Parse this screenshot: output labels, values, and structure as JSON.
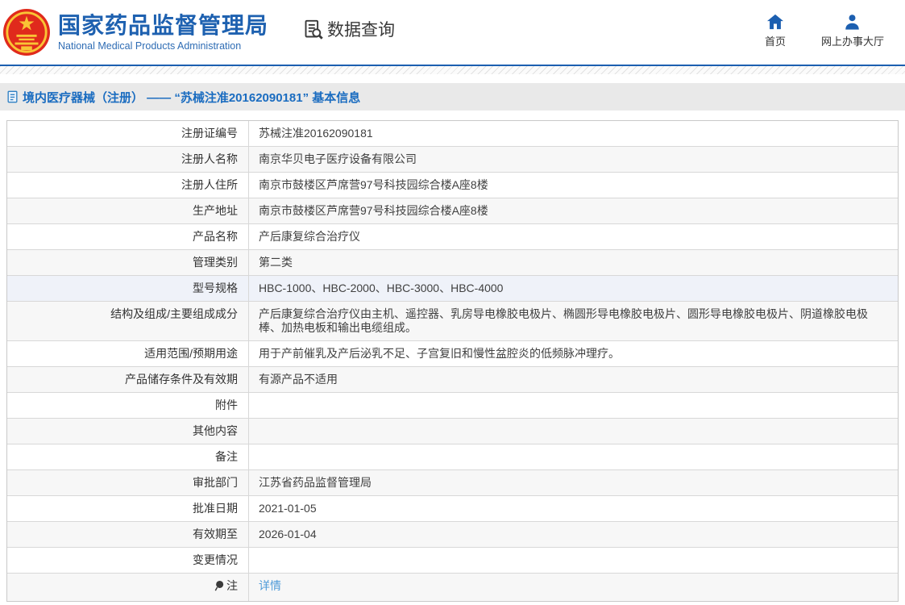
{
  "header": {
    "brand_title": "国家药品监督管理局",
    "brand_subtitle": "National Medical Products Administration",
    "section_label": "数据查询",
    "nav": [
      {
        "label": "首页",
        "icon": "home-icon"
      },
      {
        "label": "网上办事大厅",
        "icon": "user-icon"
      }
    ]
  },
  "breadcrumb": {
    "text": "境内医疗器械（注册） —— “苏械注准20162090181” 基本信息",
    "icon": "document-icon"
  },
  "table": {
    "rows": [
      {
        "label": "注册证编号",
        "value": "苏械注准20162090181"
      },
      {
        "label": "注册人名称",
        "value": "南京华贝电子医疗设备有限公司"
      },
      {
        "label": "注册人住所",
        "value": "南京市鼓楼区芦席营97号科技园综合楼A座8楼"
      },
      {
        "label": "生产地址",
        "value": "南京市鼓楼区芦席营97号科技园综合楼A座8楼"
      },
      {
        "label": "产品名称",
        "value": "产后康复综合治疗仪"
      },
      {
        "label": "管理类别",
        "value": "第二类"
      },
      {
        "label": "型号规格",
        "value": "HBC-1000、HBC-2000、HBC-3000、HBC-4000"
      },
      {
        "label": "结构及组成/主要组成成分",
        "value": "产后康复综合治疗仪由主机、遥控器、乳房导电橡胶电极片、椭圆形导电橡胶电极片、圆形导电橡胶电极片、阴道橡胶电极棒、加热电板和输出电缆组成。"
      },
      {
        "label": "适用范围/预期用途",
        "value": "用于产前催乳及产后泌乳不足、子宫复旧和慢性盆腔炎的低频脉冲理疗。"
      },
      {
        "label": "产品储存条件及有效期",
        "value": "有源产品不适用"
      },
      {
        "label": "附件",
        "value": ""
      },
      {
        "label": "其他内容",
        "value": ""
      },
      {
        "label": "备注",
        "value": ""
      },
      {
        "label": "审批部门",
        "value": "江苏省药品监督管理局"
      },
      {
        "label": "批准日期",
        "value": "2021-01-05"
      },
      {
        "label": "有效期至",
        "value": "2026-01-04"
      },
      {
        "label": "变更情况",
        "value": ""
      },
      {
        "label": "注",
        "value": "详情"
      }
    ]
  },
  "colors": {
    "brand_blue": "#1e61b0",
    "header_rule_blue": "#1c5fb0",
    "breadcrumb_text_blue": "#1a6cc0",
    "link_blue": "#4f9bd8",
    "row_gray": "#f7f7f7",
    "row_hover_blue": "#eff2f9",
    "emblem_red": "#e02a1c",
    "emblem_gold": "#f9c435"
  },
  "icons": {
    "national_emblem": "red circle with gold star and gate",
    "data_search": "document with magnifier",
    "home": "house glyph",
    "user": "person glyph",
    "breadcrumb_doc": "document sheet",
    "note_pin": "dark balloon pin"
  }
}
